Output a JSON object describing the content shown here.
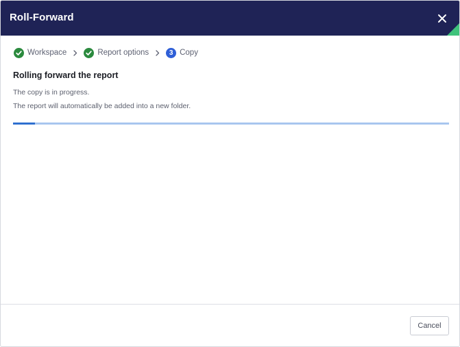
{
  "dialog": {
    "title": "Roll-Forward",
    "close_icon": "close-icon",
    "accent_color": "#3fc37b",
    "header_color": "#1f2356"
  },
  "stepper": {
    "steps": [
      {
        "label": "Workspace",
        "status": "completed",
        "icon": "check-icon"
      },
      {
        "label": "Report options",
        "status": "completed",
        "icon": "check-icon"
      },
      {
        "label": "Copy",
        "status": "active",
        "number": "3"
      }
    ],
    "separator_icon": "chevron-right-icon"
  },
  "content": {
    "heading": "Rolling forward the report",
    "status_line": "The copy is in progress.",
    "info_line": "The report will automatically be added into a new folder."
  },
  "progress": {
    "fraction": 0.05,
    "track_color": "#a8c6ef",
    "fill_color": "#2f6fd0"
  },
  "footer": {
    "cancel_label": "Cancel"
  }
}
